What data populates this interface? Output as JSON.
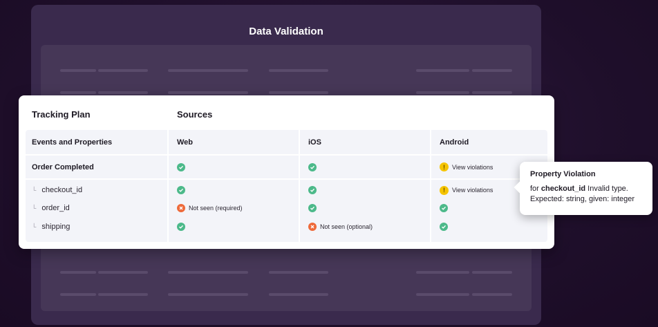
{
  "background": {
    "title": "Data Validation"
  },
  "card": {
    "tracking_plan_heading": "Tracking Plan",
    "sources_heading": "Sources",
    "columns": [
      "Events and Properties",
      "Web",
      "iOS",
      "Android"
    ],
    "event": {
      "name": "Order Completed",
      "web": "ok",
      "ios": "ok",
      "android": {
        "status": "warning",
        "text": "View violations"
      }
    },
    "properties": [
      {
        "name": "checkout_id",
        "web": {
          "status": "ok"
        },
        "ios": {
          "status": "ok"
        },
        "android": {
          "status": "warning",
          "text": "View violations"
        }
      },
      {
        "name": "order_id",
        "web": {
          "status": "error",
          "text": "Not seen (required)"
        },
        "ios": {
          "status": "ok"
        },
        "android": {
          "status": "ok"
        }
      },
      {
        "name": "shipping",
        "web": {
          "status": "ok"
        },
        "ios": {
          "status": "error",
          "text": "Not seen (optional)"
        },
        "android": {
          "status": "ok"
        }
      }
    ]
  },
  "tooltip": {
    "title": "Property Violation",
    "prefix": "for",
    "property": "checkout_id",
    "message": "Invalid type.",
    "detail": "Expected: string, given: integer"
  },
  "colors": {
    "ok": "#4cb98a",
    "error": "#ee6a3a",
    "warning": "#f5c400"
  }
}
